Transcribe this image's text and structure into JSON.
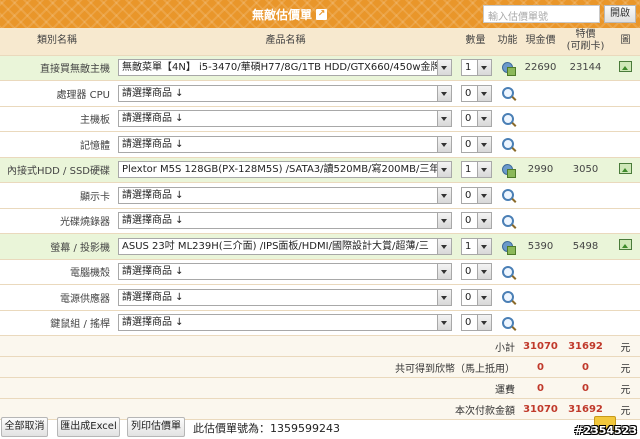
{
  "header": {
    "title": "無敵估價單",
    "search_placeholder": "輸入估價單號",
    "open_label": "開啟"
  },
  "columns": {
    "category": "類別名稱",
    "product": "產品名稱",
    "qty": "數量",
    "func": "功能",
    "cash_price_line1": "現金價",
    "card_price_line1": "特價",
    "card_price_line2": "(可刷卡)",
    "image": "圖"
  },
  "rows": [
    {
      "category": "直接買無敵主機",
      "product": "無敵菜單【4N】 i5-3470/華碩H77/8G/1TB HDD/GTX660/450w金牌",
      "qty": "1",
      "cash": "22690",
      "card": "23144",
      "has_image": true,
      "func_icon": "tools-icon"
    },
    {
      "category": "處理器 CPU",
      "product": "請選擇商品 ↓",
      "qty": "0",
      "cash": "",
      "card": "",
      "has_image": false,
      "func_icon": "search-icon"
    },
    {
      "category": "主機板",
      "product": "請選擇商品 ↓",
      "qty": "0",
      "cash": "",
      "card": "",
      "has_image": false,
      "func_icon": "search-icon"
    },
    {
      "category": "記憶體",
      "product": "請選擇商品 ↓",
      "qty": "0",
      "cash": "",
      "card": "",
      "has_image": false,
      "func_icon": "search-icon"
    },
    {
      "category": "內接式HDD / SSD硬碟",
      "product": "Plextor M5S 128GB(PX-128M5S) /SATA3/讀520MB/寫200MB/三年",
      "qty": "1",
      "cash": "2990",
      "card": "3050",
      "has_image": true,
      "func_icon": "tools-icon"
    },
    {
      "category": "顯示卡",
      "product": "請選擇商品 ↓",
      "qty": "0",
      "cash": "",
      "card": "",
      "has_image": false,
      "func_icon": "search-icon"
    },
    {
      "category": "光碟燒錄器",
      "product": "請選擇商品 ↓",
      "qty": "0",
      "cash": "",
      "card": "",
      "has_image": false,
      "func_icon": "search-icon"
    },
    {
      "category": "螢幕 / 投影機",
      "product": "ASUS 23吋 ML239H(三介面) /IPS面板/HDMI/國際設計大賞/超薄/三",
      "qty": "1",
      "cash": "5390",
      "card": "5498",
      "has_image": true,
      "func_icon": "tools-icon"
    },
    {
      "category": "電腦機殼",
      "product": "請選擇商品 ↓",
      "qty": "0",
      "cash": "",
      "card": "",
      "has_image": false,
      "func_icon": "search-icon"
    },
    {
      "category": "電源供應器",
      "product": "請選擇商品 ↓",
      "qty": "0",
      "cash": "",
      "card": "",
      "has_image": false,
      "func_icon": "search-icon"
    },
    {
      "category": "鍵鼠組 / 搖桿",
      "product": "請選擇商品 ↓",
      "qty": "0",
      "cash": "",
      "card": "",
      "has_image": false,
      "func_icon": "search-icon"
    }
  ],
  "summary": [
    {
      "label": "小計",
      "cash": "31070",
      "card": "31692",
      "unit": "元"
    },
    {
      "label": "共可得到欣幣（馬上抵用）",
      "cash": "0",
      "card": "0",
      "unit": "元"
    },
    {
      "label": "運費",
      "cash": "0",
      "card": "0",
      "unit": "元"
    },
    {
      "label": "本次付款金額",
      "cash": "31070",
      "card": "31692",
      "unit": "元"
    }
  ],
  "footer": {
    "clear_all": "全部取消",
    "export_excel": "匯出成Excel",
    "print": "列印估價單",
    "quote_number": "此估價單號為：1359599243"
  },
  "watermark": "#2354523",
  "colors": {
    "header": "#e9962a",
    "selected_row": "#eaf5d9",
    "total_red": "#c0392b"
  }
}
